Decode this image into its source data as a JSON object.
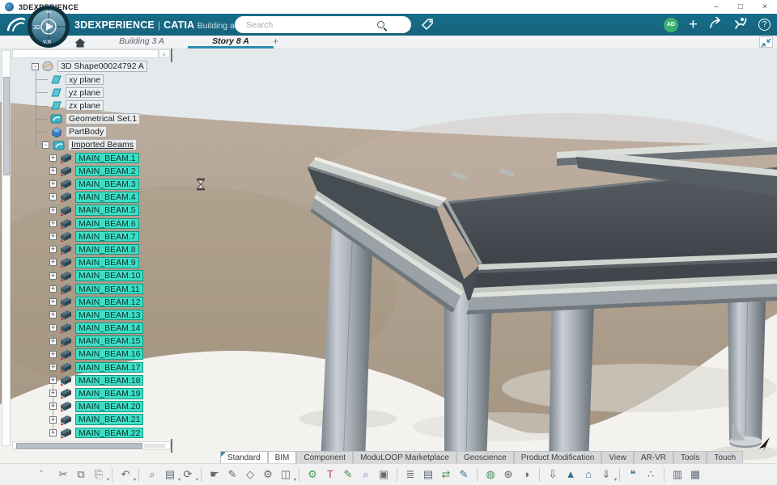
{
  "window": {
    "title": "3DEXPERIENCE",
    "minimize_glyph": "–",
    "maximize_glyph": "□",
    "close_glyph": "×"
  },
  "appbar": {
    "brand_bold": "3DEXPERIENCE",
    "brand_sep": "|",
    "brand_app": "CATIA",
    "brand_suffix": "Building and Civil Asse...",
    "search_placeholder": "Search",
    "avatar_initials": "AD",
    "plus_glyph": "+",
    "help_glyph": "?",
    "accent_color": "#176985"
  },
  "compass": {
    "top_label": "3D",
    "bottom_label": "V.R"
  },
  "tabbar": {
    "tabs": [
      {
        "label": "Building 3 A",
        "active": false
      },
      {
        "label": "Story 8 A",
        "active": true
      }
    ],
    "add_label": "+",
    "underline_color": "#2d8fae"
  },
  "tree": {
    "root": {
      "label": "3D Shape00024792 A",
      "exp": "-"
    },
    "items": [
      {
        "label": "xy plane",
        "icon": "plane"
      },
      {
        "label": "yz plane",
        "icon": "plane"
      },
      {
        "label": "zx plane",
        "icon": "plane"
      },
      {
        "label": "Geometrical Set.1",
        "icon": "geoset"
      },
      {
        "label": "PartBody",
        "icon": "partbody"
      },
      {
        "label": "Imported Beams",
        "icon": "geoset",
        "exp": "-",
        "underlined": true
      }
    ],
    "beam_expander": "+",
    "beams": [
      "MAIN_BEAM.1",
      "MAIN_BEAM.2",
      "MAIN_BEAM.3",
      "MAIN_BEAM.4",
      "MAIN_BEAM.5",
      "MAIN_BEAM.6",
      "MAIN_BEAM.7",
      "MAIN_BEAM.8",
      "MAIN_BEAM.9",
      "MAIN_BEAM.10",
      "MAIN_BEAM.11",
      "MAIN_BEAM.12",
      "MAIN_BEAM.13",
      "MAIN_BEAM.14",
      "MAIN_BEAM.15",
      "MAIN_BEAM.16",
      "MAIN_BEAM.17",
      "MAIN_BEAM.18",
      "MAIN_BEAM.19",
      "MAIN_BEAM.20",
      "MAIN_BEAM.21",
      "MAIN_BEAM.22"
    ],
    "selection_color": "#3edec6",
    "scroll_left_glyph": "‹"
  },
  "workbench_tabs": [
    {
      "label": "Standard",
      "active": true,
      "fold": true
    },
    {
      "label": "BIM",
      "active": true
    },
    {
      "label": "Component"
    },
    {
      "label": "ModuLOOP Marketplace"
    },
    {
      "label": "Geoscience"
    },
    {
      "label": "Product Modification"
    },
    {
      "label": "View"
    },
    {
      "label": "AR-VR"
    },
    {
      "label": "Tools"
    },
    {
      "label": "Touch"
    }
  ],
  "toolbar": {
    "expander_glyph": "ˇ",
    "icons": [
      {
        "name": "cut",
        "glyph": "✂"
      },
      {
        "name": "copy",
        "glyph": "⧉"
      },
      {
        "name": "paste",
        "glyph": "⎘",
        "caret": true
      },
      {
        "divider": true
      },
      {
        "name": "undo",
        "glyph": "↶",
        "caret": true
      },
      {
        "divider": true
      },
      {
        "name": "power-search",
        "glyph": "⌕"
      },
      {
        "name": "catalog-browser",
        "glyph": "▤",
        "caret": true
      },
      {
        "name": "update",
        "glyph": "⟳",
        "caret": true
      },
      {
        "divider": true
      },
      {
        "name": "manipulation",
        "glyph": "☛"
      },
      {
        "name": "tag-edit",
        "glyph": "✎"
      },
      {
        "name": "tag",
        "glyph": "◇"
      },
      {
        "name": "tag-settings",
        "glyph": "⚙"
      },
      {
        "name": "insert-existing",
        "glyph": "◫",
        "caret": true
      },
      {
        "divider": true
      },
      {
        "name": "material-gears",
        "glyph": "⚙",
        "accent": "#4a9e52"
      },
      {
        "name": "annotation-text",
        "glyph": "T",
        "accent": "#b5453b"
      },
      {
        "name": "paint-part",
        "glyph": "✎",
        "accent": "#3f8f4f"
      },
      {
        "name": "search-shape",
        "glyph": "⌕",
        "accent": "#7a6fae"
      },
      {
        "name": "iso-view",
        "glyph": "▣"
      },
      {
        "divider": true
      },
      {
        "name": "design-tree",
        "glyph": "≣"
      },
      {
        "name": "report-clipboard",
        "glyph": "▤"
      },
      {
        "name": "swap-structure",
        "glyph": "⇄",
        "accent": "#3f8f4f"
      },
      {
        "name": "sketch-cube",
        "glyph": "✎",
        "accent": "#38708e"
      },
      {
        "divider": true
      },
      {
        "name": "globe-textured",
        "glyph": "◍",
        "accent": "#4a8f5f"
      },
      {
        "name": "globe-wireframe",
        "glyph": "⊕"
      },
      {
        "name": "globe-dark",
        "glyph": "◑"
      },
      {
        "divider": true
      },
      {
        "name": "import-osm",
        "glyph": "⇩"
      },
      {
        "name": "terrain-import",
        "glyph": "▲",
        "accent": "#38708e"
      },
      {
        "name": "import-building",
        "glyph": "⌂",
        "accent": "#38708e"
      },
      {
        "name": "export-down",
        "glyph": "⇓",
        "caret": true
      },
      {
        "divider": true
      },
      {
        "name": "chat",
        "glyph": "❝",
        "accent": "#38708e"
      },
      {
        "name": "point-cloud",
        "glyph": "∴"
      },
      {
        "divider": true
      },
      {
        "name": "report-table",
        "glyph": "▥"
      },
      {
        "name": "quantity-table",
        "glyph": "▦"
      }
    ]
  },
  "scene_colors": {
    "sky": "#e4e9eb",
    "terrain": "#b0a090",
    "ground": "#f4f2ee",
    "steel_dark": "#454c52",
    "steel_flange": "#ccd0cc",
    "column": "#a9b0b6"
  }
}
